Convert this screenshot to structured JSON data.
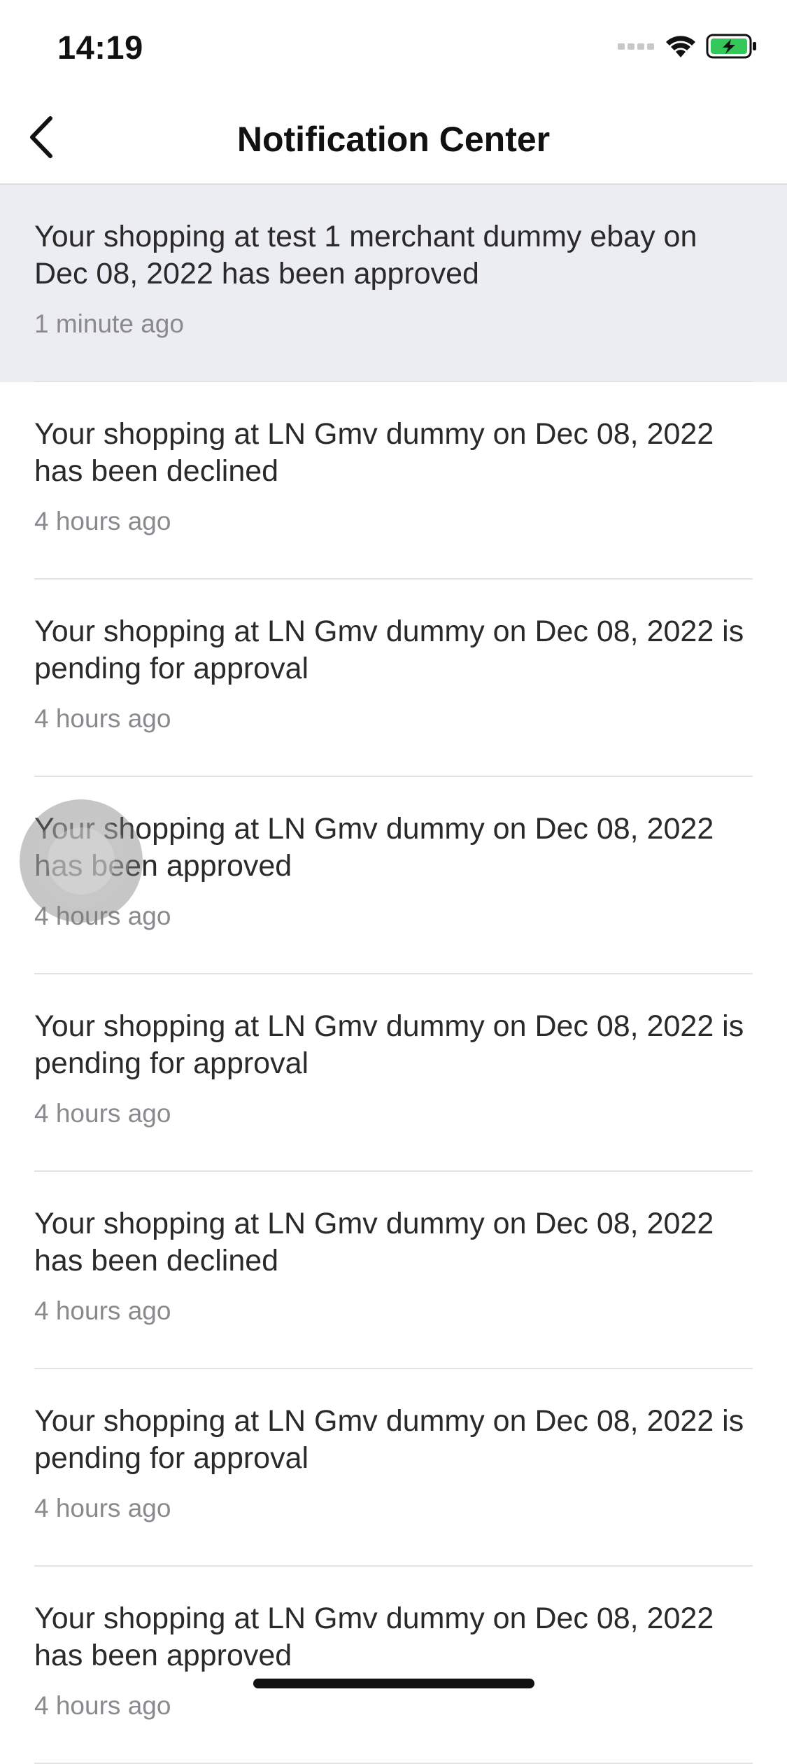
{
  "status_bar": {
    "time": "14:19",
    "battery_color": "#34c759"
  },
  "nav": {
    "title": "Notification Center",
    "back_icon": "chevron-left-icon"
  },
  "notifications": [
    {
      "text": "Your shopping at test 1 merchant dummy ebay on Dec 08, 2022 has been approved",
      "time": "1 minute ago",
      "unread": true
    },
    {
      "text": "Your shopping at LN Gmv dummy on Dec 08, 2022 has been declined",
      "time": "4 hours ago",
      "unread": false
    },
    {
      "text": "Your shopping at LN Gmv dummy on Dec 08, 2022 is pending for approval",
      "time": "4 hours ago",
      "unread": false
    },
    {
      "text": "Your shopping at LN Gmv dummy on Dec 08, 2022 has been approved",
      "time": "4 hours ago",
      "unread": false
    },
    {
      "text": "Your shopping at LN Gmv dummy on Dec 08, 2022 is pending for approval",
      "time": "4 hours ago",
      "unread": false
    },
    {
      "text": "Your shopping at LN Gmv dummy on Dec 08, 2022 has been declined",
      "time": "4 hours ago",
      "unread": false
    },
    {
      "text": "Your shopping at LN Gmv dummy on Dec 08, 2022 is pending for approval",
      "time": "4 hours ago",
      "unread": false
    },
    {
      "text": "Your shopping at LN Gmv dummy on Dec 08, 2022 has been approved",
      "time": "4 hours ago",
      "unread": false
    }
  ],
  "colors": {
    "unread_background": "#ecedf2",
    "timestamp": "#8a8a8e",
    "divider": "#e3e3e3"
  }
}
